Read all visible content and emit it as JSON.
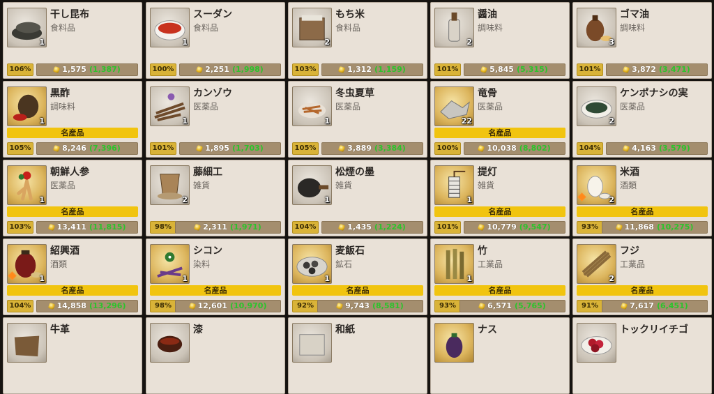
{
  "colors": {
    "card_bg": "#e9e1d7",
    "specialty_banner": "#f1c40f",
    "percent_badge": "#d9b338",
    "price_bar": "#a48e6e",
    "base_price_text": "#2bc42b"
  },
  "goods": [
    {
      "name": "干し昆布",
      "category": "食料品",
      "qty": "1",
      "percent": "106%",
      "price": "1,575",
      "base_price": "(1,387)",
      "specialty": "",
      "icon": "dried-kelp-icon",
      "thumb": "plain",
      "tier": false
    },
    {
      "name": "スーダン",
      "category": "食料品",
      "qty": "1",
      "percent": "100%",
      "price": "2,251",
      "base_price": "(1,998)",
      "specialty": "",
      "icon": "red-spice-bowl-icon",
      "thumb": "plain",
      "tier": false
    },
    {
      "name": "もち米",
      "category": "食料品",
      "qty": "2",
      "percent": "103%",
      "price": "1,312",
      "base_price": "(1,159)",
      "specialty": "",
      "icon": "rice-box-icon",
      "thumb": "plain",
      "tier": false
    },
    {
      "name": "醤油",
      "category": "調味料",
      "qty": "2",
      "percent": "101%",
      "price": "5,845",
      "base_price": "(5,315)",
      "specialty": "",
      "icon": "soy-sauce-bottle-icon",
      "thumb": "plain",
      "tier": false
    },
    {
      "name": "ゴマ油",
      "category": "調味料",
      "qty": "3",
      "percent": "101%",
      "price": "3,872",
      "base_price": "(3,471)",
      "specialty": "",
      "icon": "sesame-oil-jar-icon",
      "thumb": "plain",
      "tier": false
    },
    {
      "name": "黒酢",
      "category": "調味料",
      "qty": "1",
      "percent": "105%",
      "price": "8,246",
      "base_price": "(7,396)",
      "specialty": "名産品",
      "icon": "black-vinegar-jar-icon",
      "thumb": "gold",
      "tier": false
    },
    {
      "name": "カンゾウ",
      "category": "医薬品",
      "qty": "1",
      "percent": "101%",
      "price": "1,895",
      "base_price": "(1,703)",
      "specialty": "",
      "icon": "licorice-root-icon",
      "thumb": "plain",
      "tier": false
    },
    {
      "name": "冬虫夏草",
      "category": "医薬品",
      "qty": "1",
      "percent": "105%",
      "price": "3,889",
      "base_price": "(3,384)",
      "specialty": "",
      "icon": "cordyceps-icon",
      "thumb": "plain",
      "tier": false
    },
    {
      "name": "竜骨",
      "category": "医薬品",
      "qty": "22",
      "percent": "100%",
      "price": "10,038",
      "base_price": "(8,802)",
      "specialty": "名産品",
      "icon": "dragon-bone-icon",
      "thumb": "gold",
      "tier": false
    },
    {
      "name": "ケンポナシの実",
      "category": "医薬品",
      "qty": "2",
      "percent": "104%",
      "price": "4,163",
      "base_price": "(3,579)",
      "specialty": "",
      "icon": "raisin-tree-fruit-icon",
      "thumb": "plain",
      "tier": false
    },
    {
      "name": "朝鮮人参",
      "category": "医薬品",
      "qty": "1",
      "percent": "103%",
      "price": "13,411",
      "base_price": "(11,815)",
      "specialty": "名産品",
      "icon": "ginseng-icon",
      "thumb": "gold",
      "tier": false
    },
    {
      "name": "藤細工",
      "category": "雑貨",
      "qty": "2",
      "percent": "98%",
      "price": "2,311",
      "base_price": "(1,971)",
      "specialty": "",
      "icon": "rattan-basket-icon",
      "thumb": "plain",
      "tier": false
    },
    {
      "name": "松煙の墨",
      "category": "雑貨",
      "qty": "1",
      "percent": "104%",
      "price": "1,435",
      "base_price": "(1,224)",
      "specialty": "",
      "icon": "ink-stone-icon",
      "thumb": "plain",
      "tier": false
    },
    {
      "name": "提灯",
      "category": "雑貨",
      "qty": "1",
      "percent": "101%",
      "price": "10,779",
      "base_price": "(9,547)",
      "specialty": "名産品",
      "icon": "lantern-icon",
      "thumb": "gold",
      "tier": false
    },
    {
      "name": "米酒",
      "category": "酒類",
      "qty": "2",
      "percent": "93%",
      "price": "11,868",
      "base_price": "(10,275)",
      "specialty": "名産品",
      "icon": "rice-wine-icon",
      "thumb": "gold",
      "tier": true
    },
    {
      "name": "紹興酒",
      "category": "酒類",
      "qty": "1",
      "percent": "104%",
      "price": "14,858",
      "base_price": "(13,296)",
      "specialty": "名産品",
      "icon": "shaoxing-wine-jar-icon",
      "thumb": "gold",
      "tier": true
    },
    {
      "name": "シコン",
      "category": "染料",
      "qty": "1",
      "percent": "98%",
      "price": "12,601",
      "base_price": "(10,970)",
      "specialty": "名産品",
      "icon": "gromwell-plant-icon",
      "thumb": "gold",
      "tier": false
    },
    {
      "name": "麦飯石",
      "category": "鉱石",
      "qty": "1",
      "percent": "92%",
      "price": "9,743",
      "base_price": "(8,581)",
      "specialty": "名産品",
      "icon": "bakuhan-stone-icon",
      "thumb": "gold",
      "tier": false
    },
    {
      "name": "竹",
      "category": "工業品",
      "qty": "1",
      "percent": "93%",
      "price": "6,571",
      "base_price": "(5,765)",
      "specialty": "名産品",
      "icon": "bamboo-icon",
      "thumb": "gold",
      "tier": false
    },
    {
      "name": "フジ",
      "category": "工業品",
      "qty": "2",
      "percent": "91%",
      "price": "7,617",
      "base_price": "(6,451)",
      "specialty": "名産品",
      "icon": "wisteria-vine-icon",
      "thumb": "gold",
      "tier": false
    },
    {
      "name": "牛革",
      "category": "",
      "qty": "",
      "percent": "",
      "price": "",
      "base_price": "",
      "specialty": "",
      "icon": "ox-hide-icon",
      "thumb": "plain",
      "tier": false
    },
    {
      "name": "漆",
      "category": "",
      "qty": "",
      "percent": "",
      "price": "",
      "base_price": "",
      "specialty": "",
      "icon": "lacquer-bowl-icon",
      "thumb": "plain",
      "tier": false
    },
    {
      "name": "和紙",
      "category": "",
      "qty": "",
      "percent": "",
      "price": "",
      "base_price": "",
      "specialty": "",
      "icon": "washi-paper-icon",
      "thumb": "plain",
      "tier": false
    },
    {
      "name": "ナス",
      "category": "",
      "qty": "",
      "percent": "",
      "price": "",
      "base_price": "",
      "specialty": "",
      "icon": "eggplant-icon",
      "thumb": "gold",
      "tier": false
    },
    {
      "name": "トックリイチゴ",
      "category": "",
      "qty": "",
      "percent": "",
      "price": "",
      "base_price": "",
      "specialty": "",
      "icon": "raspberry-icon",
      "thumb": "plain",
      "tier": false
    }
  ]
}
